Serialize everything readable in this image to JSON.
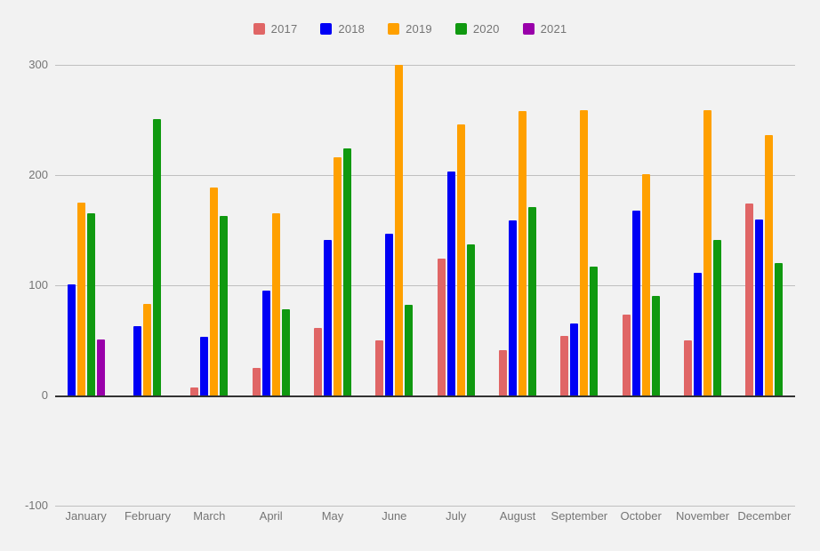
{
  "chart_data": {
    "type": "bar",
    "title": "",
    "subtitle": "",
    "xlabel": "",
    "ylabel": "",
    "ylim": [
      -100,
      300
    ],
    "yticks": [
      300,
      200,
      100,
      0,
      -100
    ],
    "ytick_labels": [
      "300",
      "200",
      "100",
      "0",
      "-100"
    ],
    "grid": true,
    "grid_axis": "y",
    "legend_position": "top-center",
    "background_color": "#f2f2f2",
    "zero_line_color": "#333333",
    "gridline_color": "#c0c0c0",
    "axis_text_color": "#757575",
    "categories": [
      "January",
      "February",
      "March",
      "April",
      "May",
      "June",
      "July",
      "August",
      "September",
      "October",
      "November",
      "December"
    ],
    "series": [
      {
        "name": "2017",
        "color": "#e06666",
        "values": [
          null,
          null,
          7,
          25,
          61,
          50,
          124,
          41,
          54,
          73,
          50,
          174
        ]
      },
      {
        "name": "2018",
        "color": "#0000f5",
        "values": [
          101,
          63,
          53,
          95,
          141,
          147,
          203,
          159,
          65,
          168,
          111,
          160
        ]
      },
      {
        "name": "2019",
        "color": "#ffa000",
        "values": [
          175,
          83,
          189,
          165,
          216,
          300,
          246,
          258,
          259,
          201,
          259,
          236
        ]
      },
      {
        "name": "2020",
        "color": "#109910",
        "values": [
          165,
          251,
          163,
          78,
          224,
          82,
          137,
          171,
          117,
          90,
          141,
          120
        ]
      },
      {
        "name": "2021",
        "color": "#9900aa",
        "values": [
          51,
          null,
          null,
          null,
          null,
          null,
          null,
          null,
          null,
          null,
          null,
          null
        ]
      }
    ]
  }
}
